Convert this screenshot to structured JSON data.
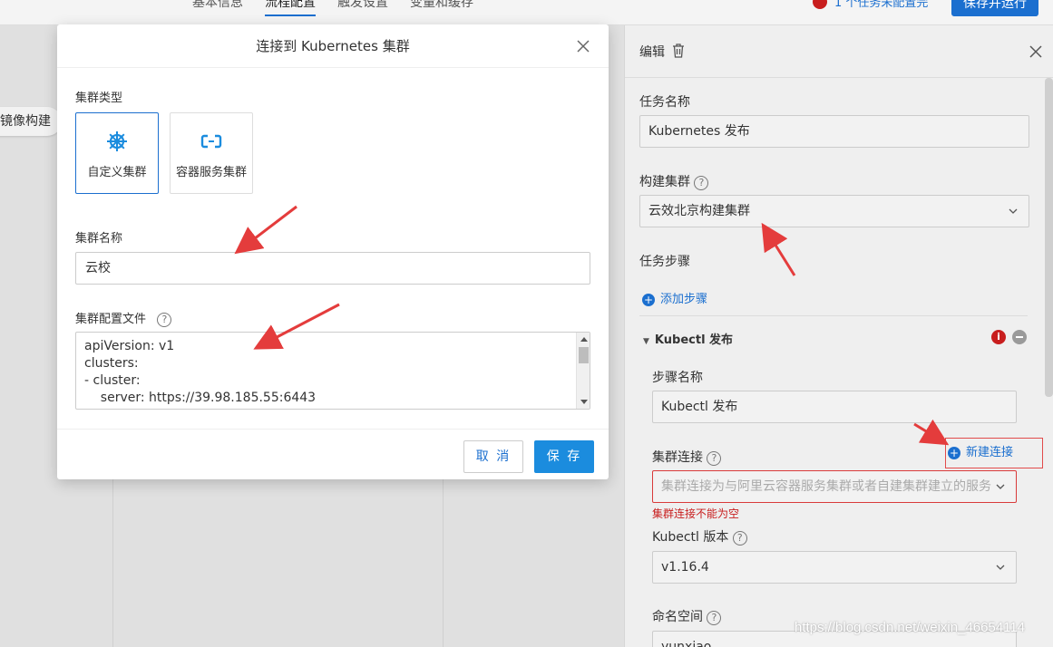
{
  "topbar": {
    "tabs": [
      "基本信息",
      "流程配置",
      "触发设置",
      "变量和缓存"
    ],
    "warning_text": "1 个任务未配置完",
    "save_run_label": "保存并运行"
  },
  "canvas": {
    "stage_chip": "镜像构建"
  },
  "modal": {
    "title": "连接到 Kubernetes 集群",
    "cluster_type_label": "集群类型",
    "cluster_types": [
      "自定义集群",
      "容器服务集群"
    ],
    "cluster_name_label": "集群名称",
    "cluster_name_value": "云校",
    "config_file_label": "集群配置文件",
    "config_lines": [
      "apiVersion: v1",
      "clusters:",
      "- cluster:",
      "    server: https://39.98.185.55:6443"
    ],
    "cancel_label": "取 消",
    "save_label": "保 存"
  },
  "panel": {
    "title": "编辑",
    "task_name_label": "任务名称",
    "task_name_value": "Kubernetes 发布",
    "build_cluster_label": "构建集群",
    "build_cluster_value": "云效北京构建集群",
    "task_steps_label": "任务步骤",
    "add_step_label": "添加步骤",
    "step_section_title": "Kubectl 发布",
    "step_name_label": "步骤名称",
    "step_name_value": "Kubectl 发布",
    "cluster_conn_label": "集群连接",
    "new_conn_label": "新建连接",
    "cluster_conn_placeholder": "集群连接为与阿里云容器服务集群或者自建集群建立的服务",
    "cluster_conn_error": "集群连接不能为空",
    "kubectl_version_label": "Kubectl 版本",
    "kubectl_version_value": "v1.16.4",
    "namespace_label": "命名空间",
    "namespace_value": "yunxiao"
  },
  "watermark": "https://blog.csdn.net/weixin_46654114",
  "colors": {
    "primary": "#1b6fcf",
    "save_button": "#1b8cde",
    "error": "#c81e1e",
    "annotation_arrow": "#e43c3c"
  }
}
